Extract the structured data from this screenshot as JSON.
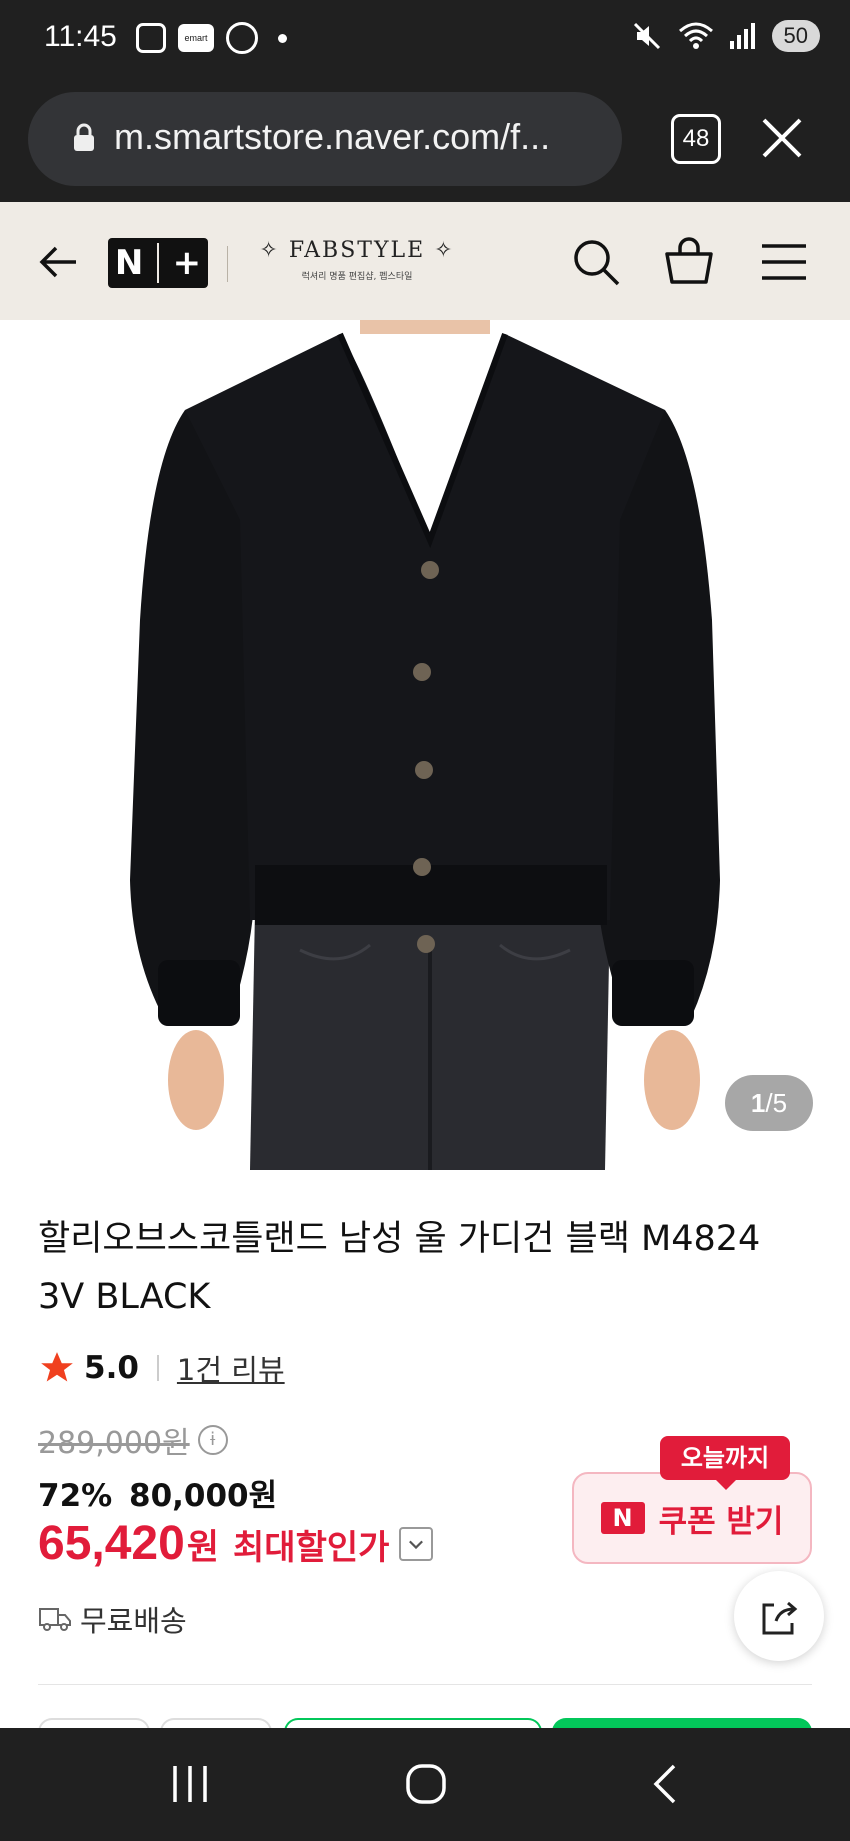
{
  "status_bar": {
    "time": "11:45",
    "emart_label": "emart",
    "battery": "50"
  },
  "browser": {
    "url": "m.smartstore.naver.com/f...",
    "tab_count": "48"
  },
  "header": {
    "nplus_label_n": "N",
    "nplus_label_plus": "+",
    "brand_name": "FABSTYLE",
    "brand_sub": "럭셔리 명품 편집샵, 펩스타일"
  },
  "gallery": {
    "current": "1",
    "separator": "/",
    "total": "5"
  },
  "product": {
    "title": "할리오브스코틀랜드 남성 울 가디건 블랙 M4824 3V BLACK",
    "rating_score": "5.0",
    "review_link": "1건 리뷰",
    "original_price": "289,000원",
    "discount_rate": "72%",
    "discounted_price": "80,000원",
    "final_price": "65,420",
    "final_unit": "원",
    "final_label": "최대할인가",
    "shipping": "무료배송"
  },
  "coupon": {
    "badge_letter": "N",
    "label": "쿠폰 받기",
    "tag": "오늘까지"
  },
  "colors": {
    "accent_red": "#e11c3a",
    "header_bg": "#efebe5",
    "system_bar": "#202020",
    "buy_green": "#03c75a"
  }
}
